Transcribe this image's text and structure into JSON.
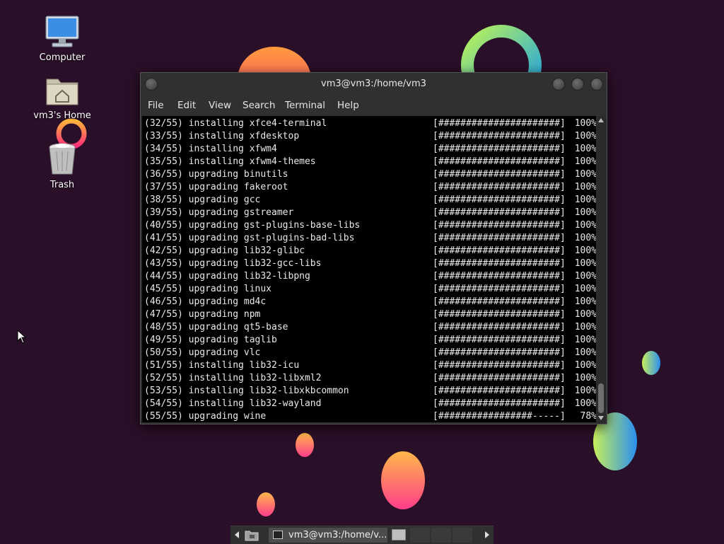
{
  "desktop": {
    "icons": [
      {
        "label": "Computer",
        "icon": "computer-icon"
      },
      {
        "label": "vm3's Home",
        "icon": "home-folder-icon"
      },
      {
        "label": "Trash",
        "icon": "trash-icon"
      }
    ]
  },
  "window": {
    "title": "vm3@vm3:/home/vm3",
    "menu": [
      "File",
      "Edit",
      "View",
      "Search",
      "Terminal",
      "Help"
    ],
    "lines": [
      {
        "text": "(32/55) installing xfce4-terminal",
        "bar": "[######################]",
        "pct": "100%"
      },
      {
        "text": "(33/55) installing xfdesktop",
        "bar": "[######################]",
        "pct": "100%"
      },
      {
        "text": "(34/55) installing xfwm4",
        "bar": "[######################]",
        "pct": "100%"
      },
      {
        "text": "(35/55) installing xfwm4-themes",
        "bar": "[######################]",
        "pct": "100%"
      },
      {
        "text": "(36/55) upgrading binutils",
        "bar": "[######################]",
        "pct": "100%"
      },
      {
        "text": "(37/55) upgrading fakeroot",
        "bar": "[######################]",
        "pct": "100%"
      },
      {
        "text": "(38/55) upgrading gcc",
        "bar": "[######################]",
        "pct": "100%"
      },
      {
        "text": "(39/55) upgrading gstreamer",
        "bar": "[######################]",
        "pct": "100%"
      },
      {
        "text": "(40/55) upgrading gst-plugins-base-libs",
        "bar": "[######################]",
        "pct": "100%"
      },
      {
        "text": "(41/55) upgrading gst-plugins-bad-libs",
        "bar": "[######################]",
        "pct": "100%"
      },
      {
        "text": "(42/55) upgrading lib32-glibc",
        "bar": "[######################]",
        "pct": "100%"
      },
      {
        "text": "(43/55) upgrading lib32-gcc-libs",
        "bar": "[######################]",
        "pct": "100%"
      },
      {
        "text": "(44/55) upgrading lib32-libpng",
        "bar": "[######################]",
        "pct": "100%"
      },
      {
        "text": "(45/55) upgrading linux",
        "bar": "[######################]",
        "pct": "100%"
      },
      {
        "text": "(46/55) upgrading md4c",
        "bar": "[######################]",
        "pct": "100%"
      },
      {
        "text": "(47/55) upgrading npm",
        "bar": "[######################]",
        "pct": "100%"
      },
      {
        "text": "(48/55) upgrading qt5-base",
        "bar": "[######################]",
        "pct": "100%"
      },
      {
        "text": "(49/55) upgrading taglib",
        "bar": "[######################]",
        "pct": "100%"
      },
      {
        "text": "(50/55) upgrading vlc",
        "bar": "[######################]",
        "pct": "100%"
      },
      {
        "text": "(51/55) installing lib32-icu",
        "bar": "[######################]",
        "pct": "100%"
      },
      {
        "text": "(52/55) installing lib32-libxml2",
        "bar": "[######################]",
        "pct": "100%"
      },
      {
        "text": "(53/55) installing lib32-libxkbcommon",
        "bar": "[######################]",
        "pct": "100%"
      },
      {
        "text": "(54/55) installing lib32-wayland",
        "bar": "[######################]",
        "pct": "100%"
      },
      {
        "text": "(55/55) upgrading wine",
        "bar": "[#################-----]",
        "pct": " 78%"
      }
    ]
  },
  "taskbar": {
    "task_label": "vm3@vm3:/home/v..."
  },
  "colors": {
    "desktop_bg": "#2a0f28",
    "terminal_bg": "#000000",
    "terminal_fg": "#e9e9e9",
    "chrome": "#303030"
  }
}
